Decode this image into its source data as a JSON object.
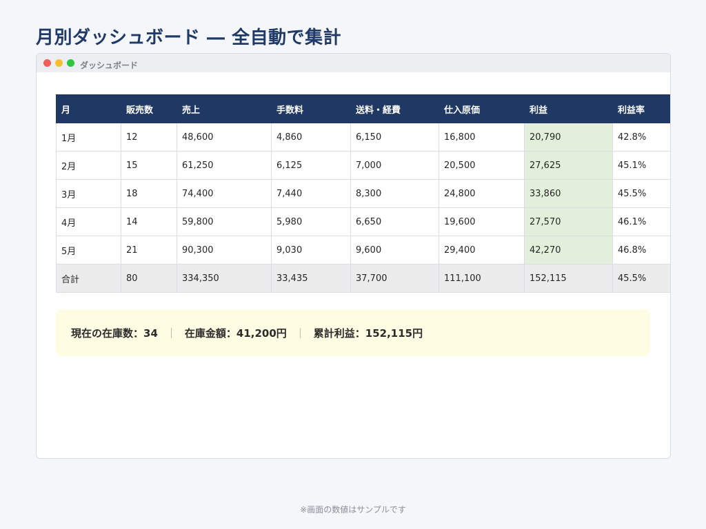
{
  "page": {
    "title": "月別ダッシュボード ― 全自動で集計",
    "footnote": "※画面の数値はサンプルです"
  },
  "window": {
    "title": "ダッシュボード",
    "controls": [
      "close",
      "minimize",
      "maximize"
    ]
  },
  "table": {
    "headers": [
      "月",
      "販売数",
      "売上",
      "手数料",
      "送料・経費",
      "仕入原価",
      "利益",
      "利益率"
    ],
    "rows": [
      [
        "1月",
        "12",
        "48,600",
        "4,860",
        "6,150",
        "16,800",
        "20,790",
        "42.8%"
      ],
      [
        "2月",
        "15",
        "61,250",
        "6,125",
        "7,000",
        "20,500",
        "27,625",
        "45.1%"
      ],
      [
        "3月",
        "18",
        "74,400",
        "7,440",
        "8,300",
        "24,800",
        "33,860",
        "45.5%"
      ],
      [
        "4月",
        "14",
        "59,800",
        "5,980",
        "6,650",
        "19,600",
        "27,570",
        "46.1%"
      ],
      [
        "5月",
        "21",
        "90,300",
        "9,030",
        "9,600",
        "29,400",
        "42,270",
        "46.8%"
      ]
    ],
    "total": [
      "合計",
      "80",
      "334,350",
      "33,435",
      "37,700",
      "111,100",
      "152,115",
      "45.5%"
    ]
  },
  "summary": {
    "stock_count": "現在の在庫数：34",
    "separator": "｜",
    "stock_value": "在庫金額：41,200円",
    "cumulative_profit": "累計利益：152,115円"
  },
  "colors": {
    "header_bg": "#1f3864",
    "profit_bg": "#e2efda",
    "total_bg": "#ececec",
    "summary_bg": "#fefde3",
    "title_color": "#1f3a66"
  }
}
